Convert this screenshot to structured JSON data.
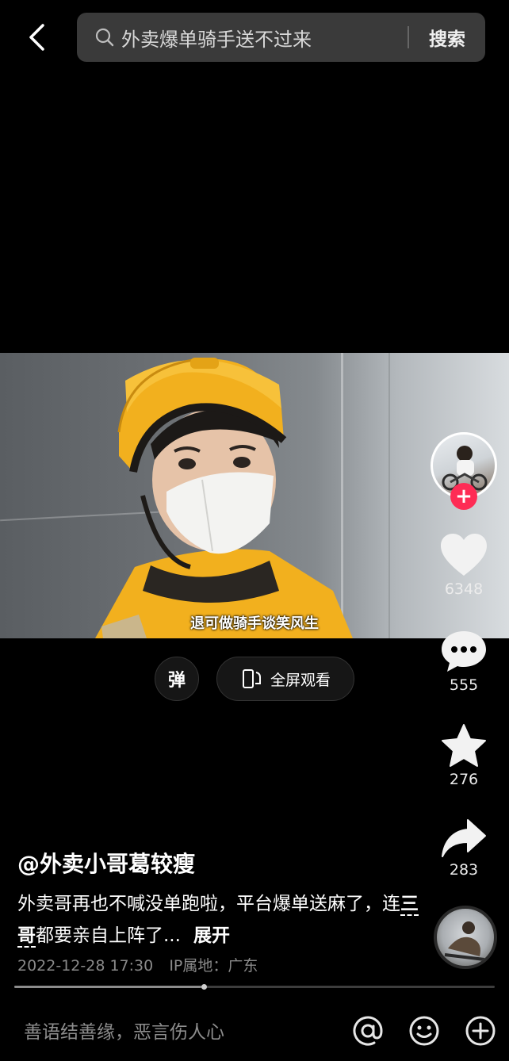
{
  "search": {
    "query": "外卖爆单骑手送不过来",
    "button_label": "搜索"
  },
  "video": {
    "subtitle": "退可做骑手谈笑风生"
  },
  "controls": {
    "danmaku_label": "弹",
    "fullscreen_label": "全屏观看"
  },
  "rail": {
    "likes": "6348",
    "comments": "555",
    "favorites": "276",
    "shares": "283",
    "follow_symbol": "+"
  },
  "post": {
    "author": "@外卖小哥葛较瘦",
    "caption_part1": "外卖哥再也不喊没单跑啦，平台爆单送麻了，连",
    "caption_topic": "三哥",
    "caption_part2": "都要亲自上阵了...",
    "expand_label": "展开",
    "timestamp": "2022-12-28 17:30",
    "location": "IP属地：广东"
  },
  "playback": {
    "progress": 0.39
  },
  "comment_bar": {
    "placeholder": "善语结善缘，恶言伤人心"
  },
  "icons": {
    "back": "chevron-left-icon",
    "search": "search-icon",
    "fullscreen": "rotate-screen-icon",
    "like": "heart-icon",
    "comment": "chat-bubble-icon",
    "favorite": "star-icon",
    "share": "share-arrow-icon",
    "at": "at-icon",
    "emoji": "emoji-icon",
    "add": "plus-circle-icon"
  },
  "colors": {
    "background": "#000000",
    "search_box": "#3a3a3a",
    "follow_accent": "#fe2c55",
    "helmet_yellow": "#f2b01e"
  }
}
